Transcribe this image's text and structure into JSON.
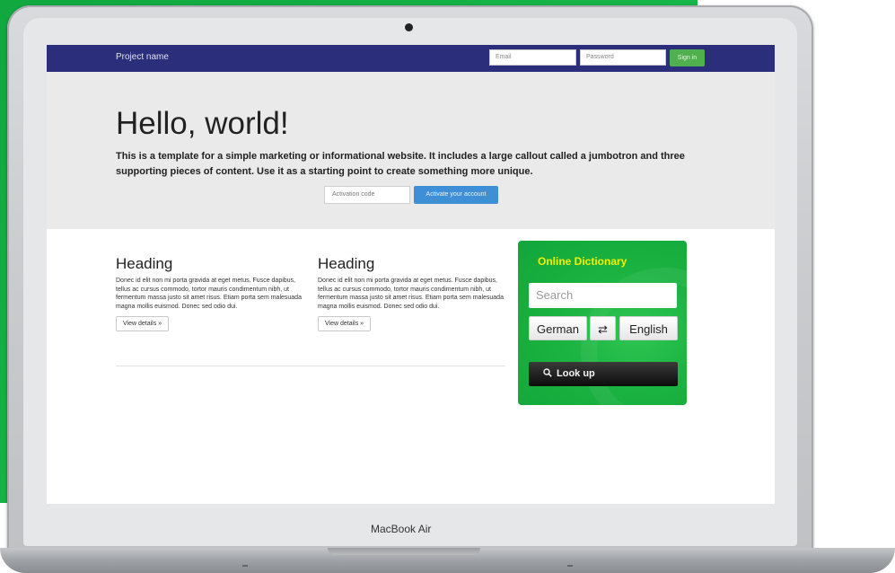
{
  "navbar": {
    "brand": "Project name",
    "email_placeholder": "Email",
    "password_placeholder": "Password",
    "signin_label": "Sign in"
  },
  "jumbotron": {
    "title": "Hello, world!",
    "lead": "This is a template for a simple marketing or informational website. It includes a large callout called a jumbotron and three supporting pieces of content. Use it as a starting point to create something more unique.",
    "activation_placeholder": "Activation code",
    "activate_label": "Activate your account"
  },
  "columns": [
    {
      "heading": "Heading",
      "body": "Donec id elit non mi porta gravida at eget metus. Fusce dapibus, tellus ac cursus commodo, tortor mauris condimentum nibh, ut fermentum massa justo sit amet risus. Etiam porta sem malesuada magna mollis euismod. Donec sed odio dui.",
      "button": "View details »"
    },
    {
      "heading": "Heading",
      "body": "Donec id elit non mi porta gravida at eget metus. Fusce dapibus, tellus ac cursus commodo, tortor mauris condimentum nibh, ut fermentum massa justo sit amet risus. Etiam porta sem malesuada magna mollis euismod. Donec sed odio dui.",
      "button": "View details »"
    }
  ],
  "dictionary": {
    "title": "Online Dictionary",
    "search_placeholder": "Search",
    "source_language": "German",
    "swap_icon": "⇄",
    "target_language": "English",
    "lookup_icon": "search-icon",
    "lookup_label": "Look up"
  },
  "device": {
    "label": "MacBook Air"
  },
  "colors": {
    "navbar": "#2a2e7b",
    "signin_button": "#4fb04d",
    "activate_button": "#3f8fd6",
    "dictionary_panel": "#1cb442",
    "dictionary_title": "#f3f000",
    "background_green": "#14b045"
  }
}
